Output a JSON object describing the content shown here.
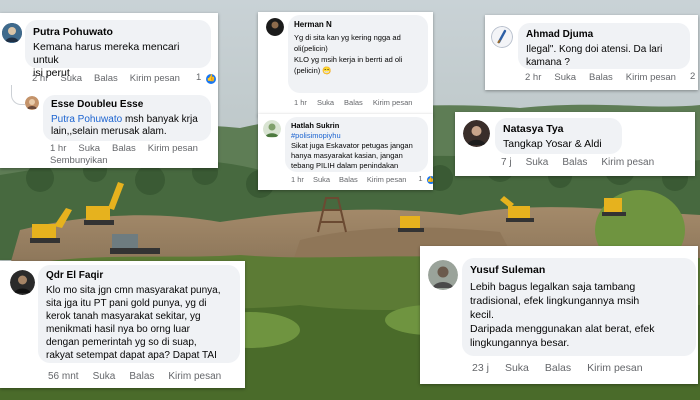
{
  "colors": {
    "like_blue": "#1877f2",
    "mention_blue": "#1b63d0",
    "bubble_bg": "#f0f2f5",
    "meta_gray": "#65676b",
    "excavator_yellow": "#e6b21e"
  },
  "comments": {
    "c1": {
      "name": "Putra Pohuwato",
      "text": "Kemana harus mereka mencari untuk\nisi perut",
      "time": "2 hr",
      "like": "Suka",
      "reply": "Balas",
      "send": "Kirim pesan",
      "likes": "1",
      "like_icon": "thumbs-up-icon"
    },
    "c1_reply": {
      "name": "Esse Doubleu Esse",
      "mention": "Putra Pohuwato",
      "text": " msh banyak krja\nlain,,selain merusak alam.",
      "time": "1 hr",
      "like": "Suka",
      "reply": "Balas",
      "send": "Kirim pesan",
      "hide": "Sembunyikan"
    },
    "c2": {
      "name": "Herman N",
      "text": "Yg di sita kan yg kering ngga ad\noli(pelicin)\nKLO yg msih kerja in berrti ad oli\n(pelicin)",
      "emoji": "😁",
      "time": "1 hr",
      "like": "Suka",
      "reply": "Balas",
      "send": "Kirim pesan"
    },
    "c3": {
      "name": "Ahmad Djuma",
      "text": "Ilegal\".  Kong doi atensi. Da lari\nkamana ?",
      "time": "2 hr",
      "like": "Suka",
      "reply": "Balas",
      "send": "Kirim pesan",
      "likes": "2",
      "like_icon": "thumbs-up-icon"
    },
    "c4": {
      "name": "Hatlah Sukrin",
      "hashtag": "#polisimopiyhu",
      "text": "Sikat juga Eskavator petugas jangan\nhanya masyarakat kasian, jangan\ntebang PILIH dalam penindakan",
      "time": "1 hr",
      "like": "Suka",
      "reply": "Balas",
      "send": "Kirim pesan",
      "likes": "1",
      "like_icon": "thumbs-up-icon"
    },
    "c5": {
      "name": "Natasya Tya",
      "text": "Tangkap Yosar & Aldi",
      "time": "7 j",
      "like": "Suka",
      "reply": "Balas",
      "send": "Kirim pesan"
    },
    "c6": {
      "name": "Qdr El Faqir",
      "text": "Klo mo sita jgn cmn masyarakat punya,\nsita jga itu PT pani gold punya, yg di\nkerok tanah masyarakat sekitar, yg\nmenikmati hasil nya bo orng luar\ndengan pemerintah yg so di suap,\nrakyat setempat dapat apa? Dapat TAI",
      "time": "56 mnt",
      "like": "Suka",
      "reply": "Balas",
      "send": "Kirim pesan"
    },
    "c7": {
      "name": "Yusuf Suleman",
      "text": "Lebih bagus legalkan saja tambang\ntradisional, efek lingkungannya msih\nkecil.\nDaripada menggunakan alat berat, efek\nlingkungannya besar.",
      "time": "23 j",
      "like": "Suka",
      "reply": "Balas",
      "send": "Kirim pesan"
    }
  }
}
